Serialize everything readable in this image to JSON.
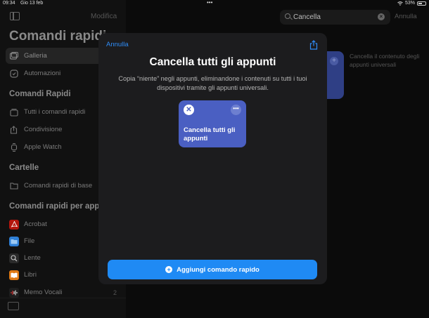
{
  "status_bar": {
    "time": "09:34",
    "date": "Gio 13 feb",
    "battery": "53%"
  },
  "sidebar": {
    "edit_label": "Modifica",
    "title": "Comandi rapidi",
    "items_top": [
      {
        "label": "Galleria",
        "icon": "gallery-icon"
      },
      {
        "label": "Automazioni",
        "icon": "automation-icon"
      }
    ],
    "section_shortcuts": "Comandi Rapidi",
    "items_shortcuts": [
      {
        "label": "Tutti i comandi rapidi",
        "icon": "stack-icon"
      },
      {
        "label": "Condivisione",
        "icon": "share-icon"
      },
      {
        "label": "Apple Watch",
        "icon": "watch-icon"
      }
    ],
    "section_folders": "Cartelle",
    "items_folders": [
      {
        "label": "Comandi rapidi di base",
        "icon": "folder-icon"
      }
    ],
    "section_apps": "Comandi rapidi per app",
    "items_apps": [
      {
        "label": "Acrobat",
        "icon": "acrobat-icon",
        "color": "#b3150c"
      },
      {
        "label": "File",
        "icon": "files-icon",
        "color": "#2f7fd6"
      },
      {
        "label": "Lente",
        "icon": "magnifier-icon",
        "color": "#2a2a2a"
      },
      {
        "label": "Libri",
        "icon": "books-icon",
        "color": "#e07a14"
      },
      {
        "label": "Memo Vocali",
        "icon": "voice-memo-icon",
        "color": "#1e1e1e",
        "count": "2"
      }
    ]
  },
  "main": {
    "search_value": "Cancella",
    "cancel_label": "Annulla",
    "card_description": "Cancella il contenuto degli appunti universali"
  },
  "modal": {
    "cancel_label": "Annulla",
    "title": "Cancella tutti gli appunti",
    "description": "Copia “niente” negli appunti, eliminandone i contenuti su tutti i tuoi dispositivi tramite gli appunti universali.",
    "tile_label": "Cancella tutti gli appunti",
    "tile_color": "#4a5fc2",
    "add_button_label": "Aggiungi comando rapido",
    "accent_color": "#1f8af4"
  }
}
